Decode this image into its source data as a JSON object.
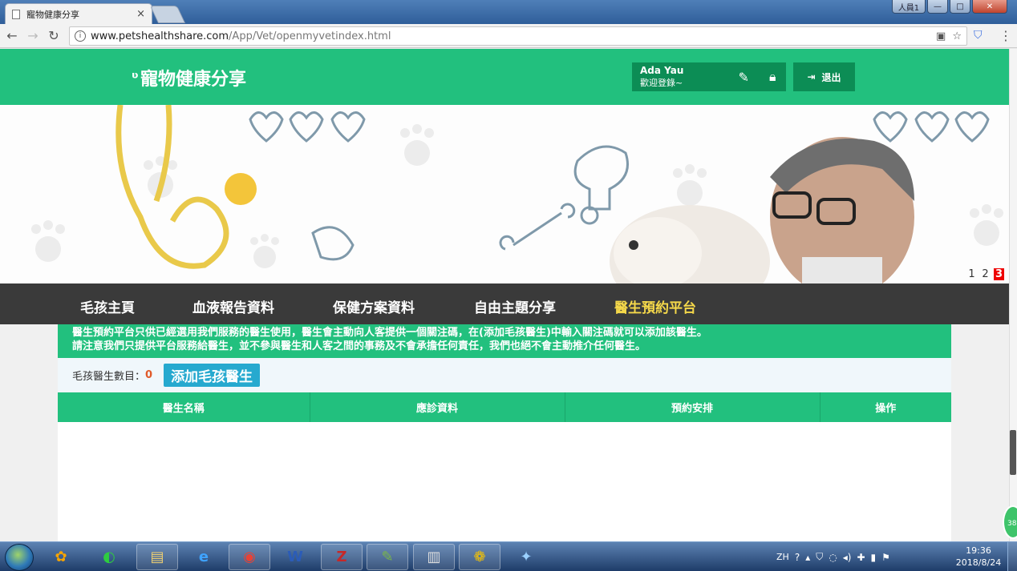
{
  "browser": {
    "tab_title": "寵物健康分享",
    "tab_close": "×",
    "url_host": "www.petshealthshare.com",
    "url_path": "/App/Vet/openmyvetindex.html",
    "profile_label": "人員1",
    "minimize": "—",
    "maximize": "□",
    "close": "✕"
  },
  "header": {
    "logo_text": "寵物健康分享",
    "user_name": "Ada Yau",
    "welcome": "歡迎登錄~",
    "logout_label": "退出"
  },
  "banner": {
    "pages": [
      "1",
      "2",
      "3"
    ],
    "active_page": "3"
  },
  "nav": {
    "items": [
      "毛孩主頁",
      "血液報告資料",
      "保健方案資料",
      "自由主題分享",
      "醫生預約平台"
    ],
    "active": "醫生預約平台"
  },
  "notice": {
    "line1": "醫生預約平台只供已經選用我們服務的醫生使用，醫生會主動向人客提供一個關注碼，在(添加毛孩醫生)中輸入關注碼就可以添加該醫生。",
    "line2": "請注意我們只提供平台服務給醫生，並不參與醫生和人客之間的事務及不會承擔任何責任，我們也絕不會主動推介任何醫生。"
  },
  "count": {
    "label": "毛孩醫生數目：",
    "value": "0",
    "add_button": "添加毛孩醫生"
  },
  "table": {
    "headers": [
      "醫生名稱",
      "應診資料",
      "預約安排",
      "操作"
    ],
    "rows": []
  },
  "badge": {
    "text": "38"
  },
  "taskbar": {
    "ime": "ZH",
    "time": "19:36",
    "date": "2018/8/24"
  },
  "colors": {
    "brand_green": "#22c07e",
    "dark_green": "#0c8d55",
    "nav_dark": "#3a3a3a",
    "nav_active": "#f5d84a",
    "add_button": "#26a9cf",
    "count_value": "#e05a2a"
  }
}
